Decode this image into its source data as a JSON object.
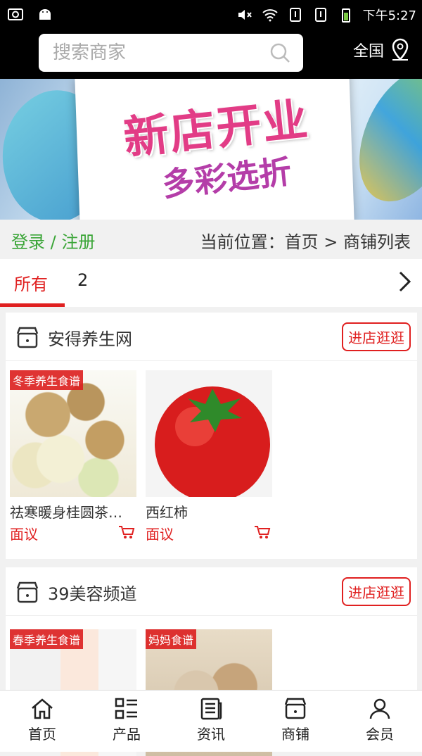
{
  "status_bar": {
    "time": "下午5:27"
  },
  "header": {
    "search_placeholder": "搜索商家",
    "region": "全国"
  },
  "banner": {
    "title_line1": "新店开业",
    "title_line2": "多彩选折"
  },
  "account": {
    "login": "登录 / 注册"
  },
  "breadcrumb": {
    "text": "当前位置：首页 > 商铺列表"
  },
  "tabs": {
    "all": "所有",
    "second": "2"
  },
  "shops": [
    {
      "name": "安得养生网",
      "visit_label": "进店逛逛",
      "products": [
        {
          "name": "祛寒暖身桂圆茶…",
          "price": "面议",
          "tag": "冬季养生食谱"
        },
        {
          "name": "西红柿",
          "price": "面议",
          "tag": ""
        }
      ]
    },
    {
      "name": "39美容频道",
      "visit_label": "进店逛逛",
      "products": [
        {
          "tag": "春季养生食谱"
        },
        {
          "tag": "妈妈食谱"
        }
      ]
    }
  ],
  "bottom_nav": [
    {
      "label": "首页",
      "icon": "home-icon"
    },
    {
      "label": "产品",
      "icon": "grid-list-icon"
    },
    {
      "label": "资讯",
      "icon": "news-icon"
    },
    {
      "label": "商铺",
      "icon": "shop-icon"
    },
    {
      "label": "会员",
      "icon": "user-icon"
    }
  ]
}
